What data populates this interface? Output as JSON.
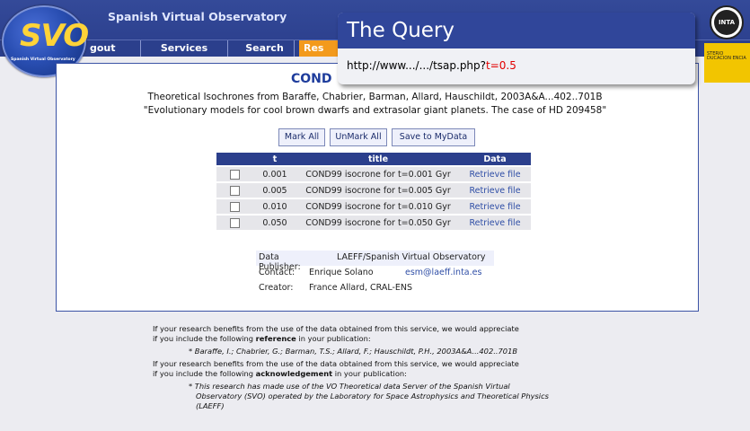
{
  "header": {
    "site_title": "Spanish Virtual Observatory",
    "logo_text": "SVO",
    "logo_sub": "Spanish Virtual Observatory",
    "inta_label": "INTA",
    "ministry_text": "STERIO DUCACION ENCIA"
  },
  "nav": {
    "logout": "gout",
    "services": "Services",
    "search": "Search",
    "results": "Res"
  },
  "panel": {
    "title": "COND",
    "subtitle_line1": "Theoretical Isochrones from Baraffe, Chabrier, Barman, Allard, Hauschildt, 2003A&A...402..701B",
    "subtitle_line2": "\"Evolutionary models for cool brown dwarfs and extrasolar giant planets. The case of HD 209458\""
  },
  "buttons": {
    "mark_all": "Mark All",
    "unmark_all": "UnMark All",
    "save": "Save to MyData"
  },
  "table": {
    "headers": [
      "t",
      "title",
      "Data"
    ],
    "rows": [
      {
        "t": "0.001",
        "title": "COND99 isocrone for t=0.001 Gyr",
        "data": "Retrieve file"
      },
      {
        "t": "0.005",
        "title": "COND99 isocrone for t=0.005 Gyr",
        "data": "Retrieve file"
      },
      {
        "t": "0.010",
        "title": "COND99 isocrone for t=0.010 Gyr",
        "data": "Retrieve file"
      },
      {
        "t": "0.050",
        "title": "COND99 isocrone for t=0.050 Gyr",
        "data": "Retrieve file"
      }
    ]
  },
  "meta": {
    "publisher_label": "Data Publisher:",
    "publisher_value": "LAEFF/Spanish Virtual Observatory",
    "contact_label": "Contact:",
    "contact_name": "Enrique Solano",
    "contact_email": "esm@laeff.inta.es",
    "creator_label": "Creator:",
    "creator_value": "France Allard, CRAL-ENS"
  },
  "footer": {
    "ref_intro_1": "If your research benefits from the use of the data obtained from this service, we would appreciate",
    "ref_intro_2a": "if you include the following ",
    "ref_intro_2b": "reference",
    "ref_intro_2c": " in your publication:",
    "ref_citation": "* Baraffe, I.; Chabrier, G.; Barman, T.S.; Allard, F.; Hauschildt, P.H., 2003A&A...402..701B",
    "ack_intro_1": "If your research benefits from the use of the data obtained from this service, we would appreciate",
    "ack_intro_2a": "if you include the following ",
    "ack_intro_2b": "acknowledgement",
    "ack_intro_2c": " in your publication:",
    "ack_text_1": "* This research has made use of the VO Theoretical data Server of the Spanish Virtual",
    "ack_text_2": "Observatory (SVO) operated by the Laboratory for Space Astrophysics and Theoretical Physics",
    "ack_text_3": "(LAEFF)"
  },
  "callout": {
    "title": "The Query",
    "url_prefix": "http://www.../.../tsap.php?",
    "url_param": "t=0.5"
  },
  "colors": {
    "navy": "#2b3f8c",
    "orange": "#f39a1c",
    "link": "#2f4ea6",
    "red": "#e20000"
  }
}
